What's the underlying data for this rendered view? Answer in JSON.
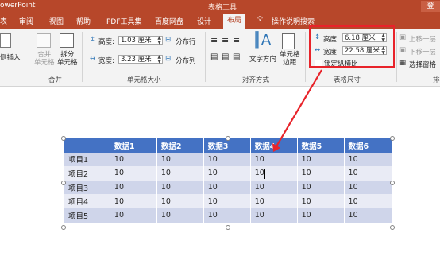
{
  "titlebar": {
    "app": "owerPoint",
    "context_tools": "表格工具",
    "login": "登"
  },
  "tabs": [
    {
      "label": "表",
      "active": false
    },
    {
      "label": "审阅",
      "active": false
    },
    {
      "label": "视图",
      "active": false
    },
    {
      "label": "帮助",
      "active": false
    },
    {
      "label": "PDF工具集",
      "active": false
    },
    {
      "label": "百度网盘",
      "active": false
    },
    {
      "label": "设计",
      "active": false
    },
    {
      "label": "布局",
      "active": true
    }
  ],
  "tellme": "操作说明搜索",
  "ribbon": {
    "insert_label": "侧插入",
    "merge_cells": "合并\n单元格",
    "split_cells": "拆分\n单元格",
    "merge_group": "合并",
    "cell_height_label": "高度:",
    "cell_height_value": "1.03 厘米",
    "cell_width_label": "宽度:",
    "cell_width_value": "3.23 厘米",
    "distribute_rows": "分布行",
    "distribute_cols": "分布列",
    "cell_size_group": "单元格大小",
    "text_direction": "文字方向",
    "cell_margins": "单元格\n边距",
    "align_group": "对齐方式",
    "table_height_label": "高度:",
    "table_height_value": "6.18 厘米",
    "table_width_label": "宽度:",
    "table_width_value": "22.58 厘米",
    "lock_aspect": "锁定纵横比",
    "table_size_group": "表格尺寸",
    "bring_forward": "上移一层",
    "send_backward": "下移一层",
    "selection_pane": "选择窗格",
    "arrange_group": "排"
  },
  "table": {
    "headers": [
      "",
      "数据1",
      "数据2",
      "数据3",
      "数据4",
      "数据5",
      "数据6"
    ],
    "rows": [
      [
        "项目1",
        "10",
        "10",
        "10",
        "10",
        "10",
        "10"
      ],
      [
        "项目2",
        "10",
        "10",
        "10",
        "10",
        "10",
        "10"
      ],
      [
        "项目3",
        "10",
        "10",
        "10",
        "10",
        "10",
        "10"
      ],
      [
        "项目4",
        "10",
        "10",
        "10",
        "10",
        "10",
        "10"
      ],
      [
        "项目5",
        "10",
        "10",
        "10",
        "10",
        "10",
        "10"
      ]
    ]
  },
  "colors": {
    "brand": "#b7472a",
    "highlight": "#e8232a",
    "table_header": "#4472c4",
    "table_band_dark": "#cfd5ea",
    "table_band_light": "#e9ebf5"
  }
}
